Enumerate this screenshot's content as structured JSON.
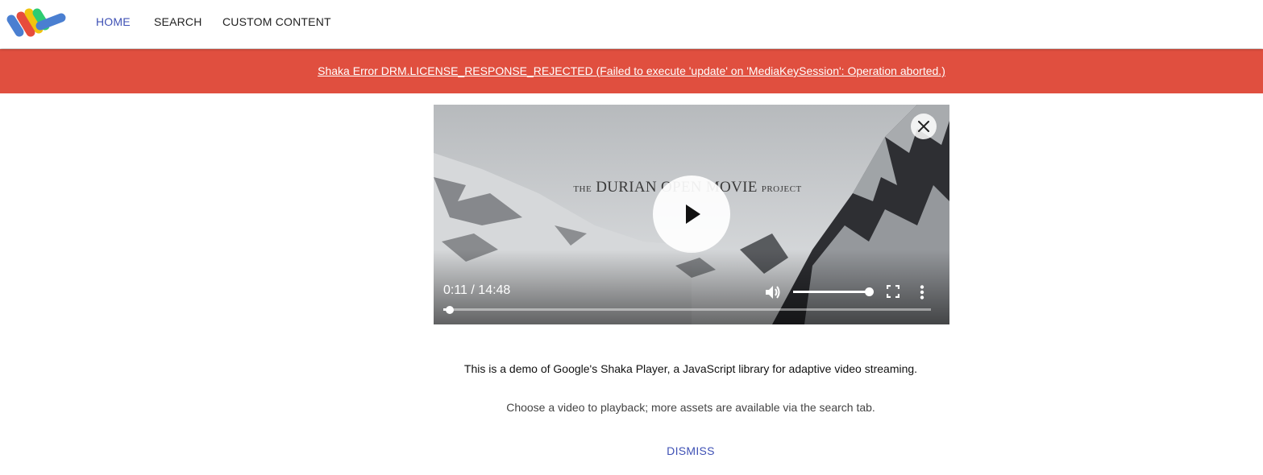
{
  "header": {
    "logo_icon": "shaka-logo-icon",
    "nav": [
      {
        "label": "HOME",
        "active": true
      },
      {
        "label": "SEARCH",
        "active": false
      },
      {
        "label": "CUSTOM CONTENT",
        "active": false
      }
    ],
    "accent_color": "#3f51b5"
  },
  "error_banner": {
    "text": "Shaka Error DRM.LICENSE_RESPONSE_REJECTED (Failed to execute 'update' on 'MediaKeySession': Operation aborted.)",
    "color": "#e04f3f"
  },
  "player": {
    "video_title_line": {
      "prefix": "THE",
      "main": "DURIAN OPEN MOVIE",
      "suffix": "PROJECT"
    },
    "time": "0:11 / 14:48",
    "progress_fraction": 0.0124,
    "volume_fraction": 1.0,
    "icons": {
      "close": "close-icon",
      "play": "play-icon",
      "volume": "volume-icon",
      "fullscreen": "fullscreen-icon",
      "overflow": "more-vert-icon"
    }
  },
  "content": {
    "description": "This is a demo of Google's Shaka Player, a JavaScript library for adaptive video streaming.",
    "hint": "Choose a video to playback; more assets are available via the search tab.",
    "dismiss_label": "DISMISS"
  }
}
